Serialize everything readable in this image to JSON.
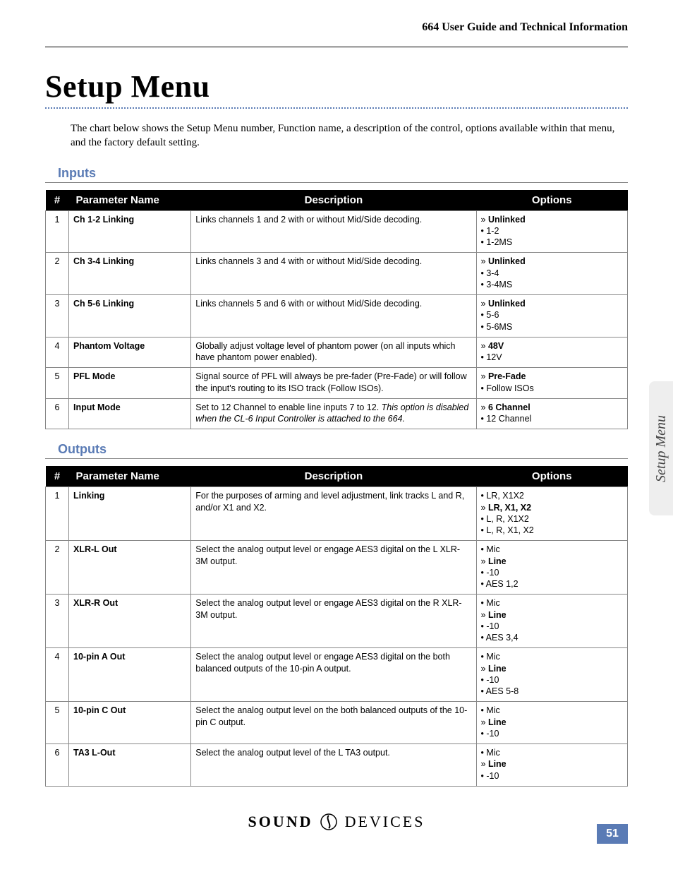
{
  "runningHead": "664 User Guide and Technical Information",
  "title": "Setup Menu",
  "intro": "The chart below shows the Setup Menu number, Function name, a description of the control, options available within that menu, and the factory default setting.",
  "sideTab": "Setup Menu",
  "pageNumber": "51",
  "footer": {
    "left": "SOUND",
    "right": "DEVICES"
  },
  "columns": {
    "num": "#",
    "param": "Parameter Name",
    "desc": "Description",
    "opts": "Options"
  },
  "sections": [
    {
      "heading": "Inputs",
      "rows": [
        {
          "num": "1",
          "param": "Ch 1-2 Linking",
          "desc": "Links channels 1 and 2 with or without Mid/Side decoding.",
          "opts": [
            {
              "label": "Unlinked",
              "default": true
            },
            {
              "label": "1-2",
              "default": false
            },
            {
              "label": "1-2MS",
              "default": false
            }
          ]
        },
        {
          "num": "2",
          "param": "Ch 3-4 Linking",
          "desc": "Links channels 3 and 4 with or without Mid/Side decoding.",
          "opts": [
            {
              "label": "Unlinked",
              "default": true
            },
            {
              "label": "3-4",
              "default": false
            },
            {
              "label": "3-4MS",
              "default": false
            }
          ]
        },
        {
          "num": "3",
          "param": "Ch 5-6 Linking",
          "desc": "Links channels 5 and 6 with or without Mid/Side decoding.",
          "opts": [
            {
              "label": "Unlinked",
              "default": true
            },
            {
              "label": "5-6",
              "default": false
            },
            {
              "label": "5-6MS",
              "default": false
            }
          ]
        },
        {
          "num": "4",
          "param": "Phantom Voltage",
          "desc": "Globally adjust voltage level of phantom power (on all inputs which have phantom power enabled).",
          "opts": [
            {
              "label": "48V",
              "default": true
            },
            {
              "label": "12V",
              "default": false
            }
          ]
        },
        {
          "num": "5",
          "param": "PFL Mode",
          "desc": "Signal source of PFL will always be pre-fader (Pre-Fade) or will follow the input's routing to its ISO track (Follow ISOs).",
          "opts": [
            {
              "label": "Pre-Fade",
              "default": true
            },
            {
              "label": "Follow ISOs",
              "default": false
            }
          ]
        },
        {
          "num": "6",
          "param": "Input Mode",
          "desc": "Set to 12 Channel to enable line inputs 7 to 12. ",
          "descItalic": "This option is disabled when the CL-6 Input Controller is attached to the 664.",
          "opts": [
            {
              "label": "6 Channel",
              "default": true
            },
            {
              "label": "12 Channel",
              "default": false
            }
          ]
        }
      ]
    },
    {
      "heading": "Outputs",
      "rows": [
        {
          "num": "1",
          "param": "Linking",
          "desc": "For the purposes of arming and level adjustment, link tracks L and R, and/or X1 and X2.",
          "opts": [
            {
              "label": "LR, X1X2",
              "default": false
            },
            {
              "label": "LR, X1, X2",
              "default": true
            },
            {
              "label": "L, R, X1X2",
              "default": false
            },
            {
              "label": "L, R, X1, X2",
              "default": false
            }
          ]
        },
        {
          "num": "2",
          "param": "XLR-L Out",
          "desc": "Select the analog output level or engage AES3 digital on the L XLR-3M output.",
          "opts": [
            {
              "label": "Mic",
              "default": false
            },
            {
              "label": "Line",
              "default": true
            },
            {
              "label": "-10",
              "default": false
            },
            {
              "label": "AES 1,2",
              "default": false
            }
          ]
        },
        {
          "num": "3",
          "param": "XLR-R Out",
          "desc": "Select the analog output level or engage AES3 digital on the R XLR-3M output.",
          "opts": [
            {
              "label": "Mic",
              "default": false
            },
            {
              "label": "Line",
              "default": true
            },
            {
              "label": "-10",
              "default": false
            },
            {
              "label": "AES 3,4",
              "default": false
            }
          ]
        },
        {
          "num": "4",
          "param": "10-pin A Out",
          "desc": "Select the analog output level or engage AES3 digital on the both balanced outputs of the 10-pin A output.",
          "opts": [
            {
              "label": "Mic",
              "default": false
            },
            {
              "label": "Line",
              "default": true
            },
            {
              "label": "-10",
              "default": false
            },
            {
              "label": "AES 5-8",
              "default": false
            }
          ]
        },
        {
          "num": "5",
          "param": "10-pin C Out",
          "desc": "Select the analog output level on the both balanced outputs of the 10-pin C output.",
          "opts": [
            {
              "label": "Mic",
              "default": false
            },
            {
              "label": "Line",
              "default": true
            },
            {
              "label": "-10",
              "default": false
            }
          ]
        },
        {
          "num": "6",
          "param": "TA3 L-Out",
          "desc": "Select the analog output level of the L TA3 output.",
          "opts": [
            {
              "label": "Mic",
              "default": false
            },
            {
              "label": "Line",
              "default": true
            },
            {
              "label": "-10",
              "default": false
            }
          ]
        }
      ]
    }
  ]
}
